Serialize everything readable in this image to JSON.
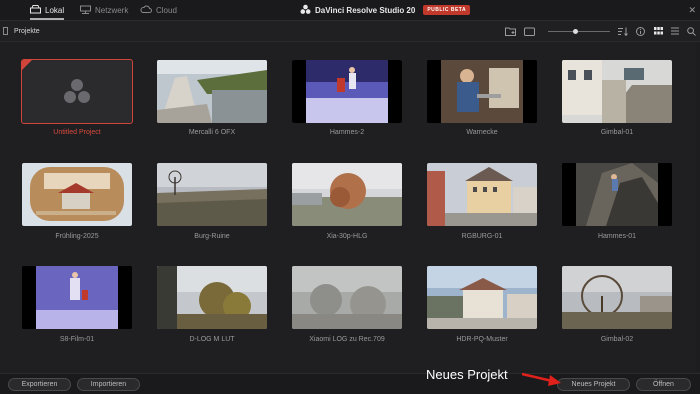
{
  "topbar": {
    "tabs": [
      {
        "label": "Lokal",
        "icon": "local-drive-icon",
        "active": true
      },
      {
        "label": "Netzwerk",
        "icon": "network-icon",
        "active": false
      },
      {
        "label": "Cloud",
        "icon": "cloud-icon",
        "active": false
      }
    ],
    "app_title": "DaVinci Resolve Studio 20",
    "badge": "PUBLIC BETA"
  },
  "toolbar": {
    "breadcrumb": "Projekte",
    "zoom_level": 0.45,
    "tools": [
      "new-folder-icon",
      "folder-icon",
      "sort-icon",
      "info-icon",
      "grid-view-icon",
      "list-view-icon",
      "search-icon"
    ]
  },
  "projects": [
    {
      "name": "Untitled Project",
      "selected": true
    },
    {
      "name": "Mercalli 6 OFX"
    },
    {
      "name": "Hammes-2"
    },
    {
      "name": "Warnecke"
    },
    {
      "name": "Gimbal-01"
    },
    {
      "name": "Frühling-2025"
    },
    {
      "name": "Burg-Ruine"
    },
    {
      "name": "Xia-30p-HLG"
    },
    {
      "name": "RGBURG-01"
    },
    {
      "name": "Hammes-01"
    },
    {
      "name": "S8-Film-01"
    },
    {
      "name": "D-LOG M LUT"
    },
    {
      "name": "Xiaomi LOG zu Rec.709"
    },
    {
      "name": "HDR-PQ-Muster"
    },
    {
      "name": "Gimbal-02"
    }
  ],
  "bottombar": {
    "export_label": "Exportieren",
    "import_label": "Importieren",
    "new_project_label": "Neues Projekt",
    "open_label": "Öffnen"
  },
  "annotation": "Neues Projekt",
  "colors": {
    "accent": "#d0453a",
    "arrow": "#e0201a"
  }
}
